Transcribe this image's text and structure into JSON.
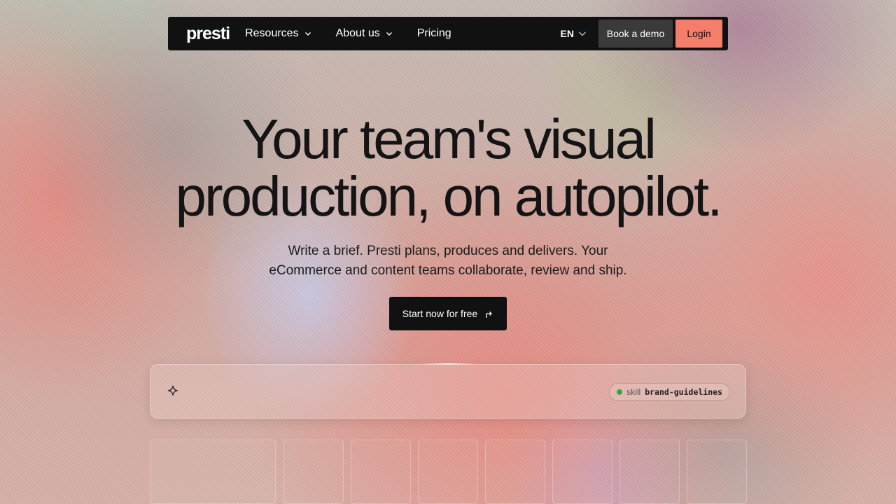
{
  "nav": {
    "logo": "presti",
    "links": [
      {
        "label": "Resources",
        "dropdown": true
      },
      {
        "label": "About us",
        "dropdown": true
      },
      {
        "label": "Pricing",
        "dropdown": false
      }
    ],
    "language": "EN",
    "book_demo_label": "Book a demo",
    "login_label": "Login"
  },
  "hero": {
    "title_line1": "Your team's visual",
    "title_line2": "production, on autopilot.",
    "subtitle_line1": "Write a brief. Presti plans, produces and delivers. Your",
    "subtitle_line2": "eCommerce and content teams collaborate, review and ship.",
    "cta_label": "Start now for free"
  },
  "prompt": {
    "icon": "sparkle-icon",
    "skill_key": "skill",
    "skill_value": "brand-guidelines",
    "skill_status_color": "#2fa84a"
  },
  "colors": {
    "nav_bg": "#111111",
    "login_accent": "#f47e6a",
    "demo_bg": "#3a3a3a"
  }
}
